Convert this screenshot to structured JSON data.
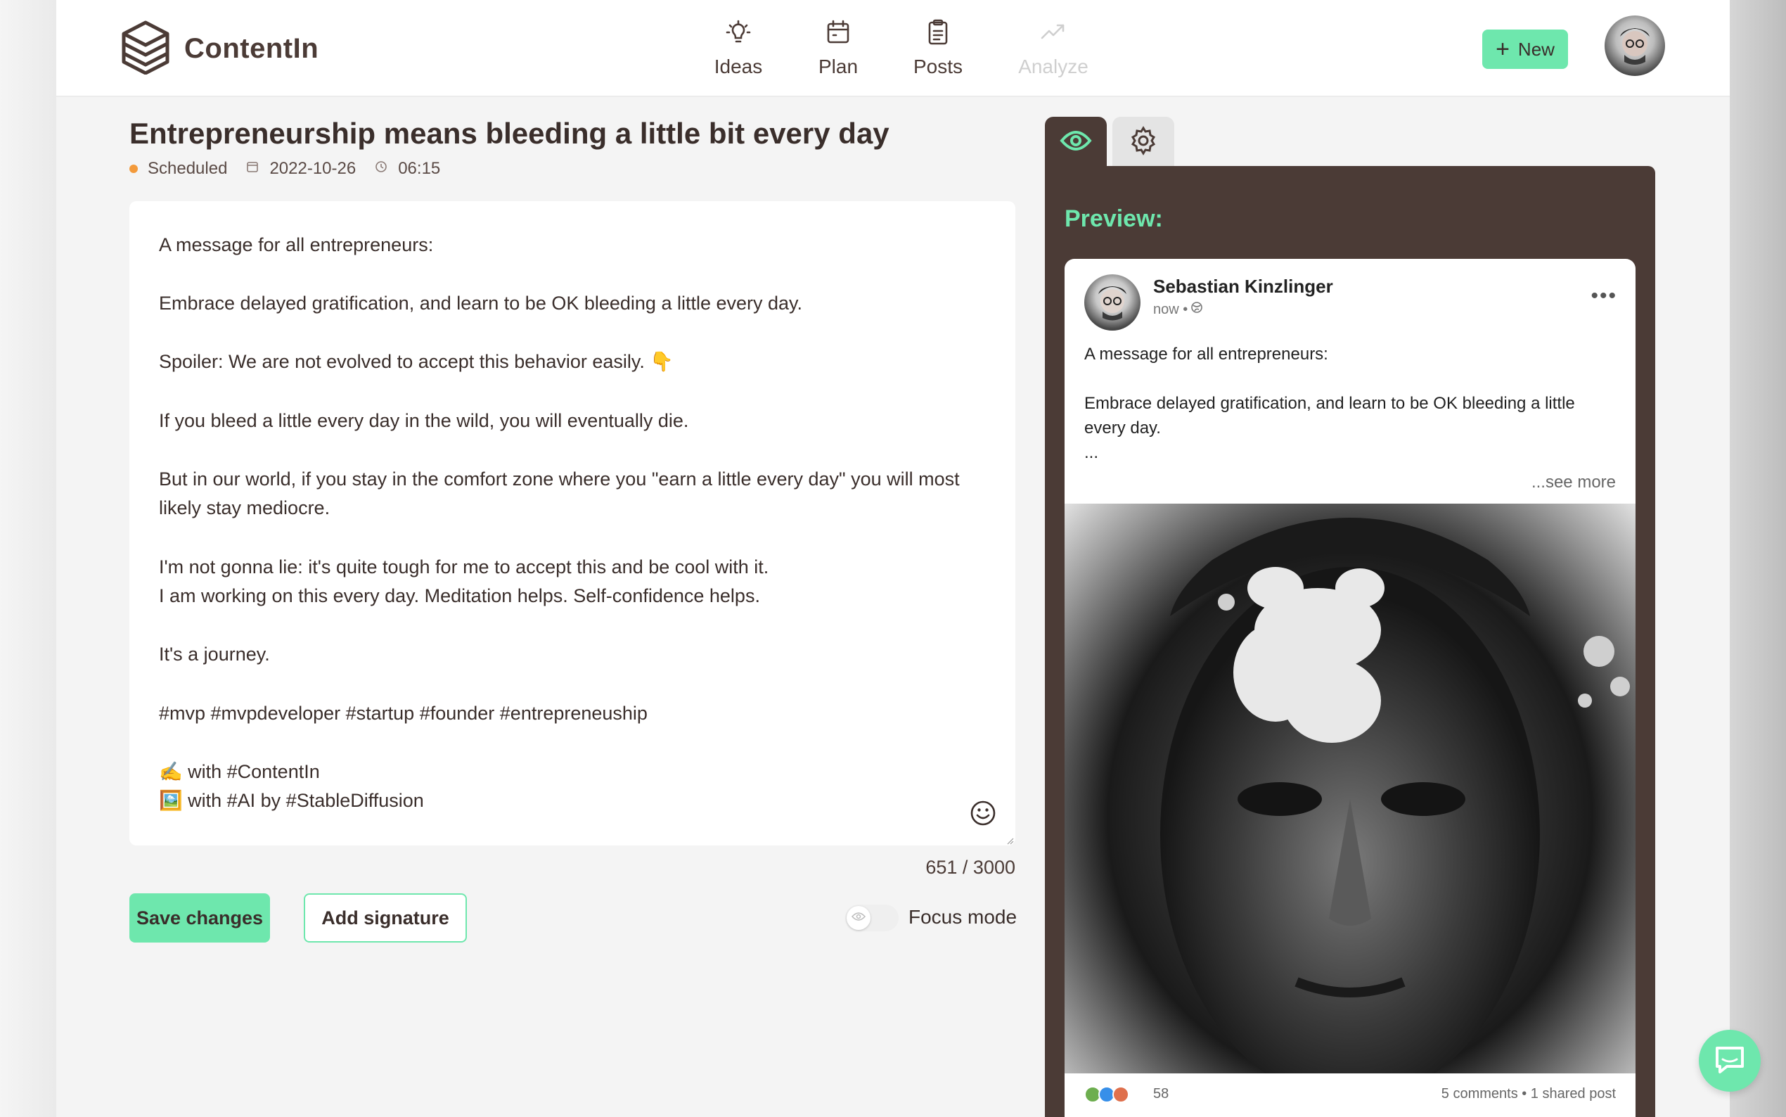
{
  "app": {
    "name": "ContentIn"
  },
  "nav": {
    "items": [
      {
        "label": "Ideas",
        "icon": "lightbulb-icon"
      },
      {
        "label": "Plan",
        "icon": "calendar-icon"
      },
      {
        "label": "Posts",
        "icon": "clipboard-icon"
      },
      {
        "label": "Analyze",
        "icon": "trend-icon",
        "disabled": true
      }
    ]
  },
  "header": {
    "new_label": "New"
  },
  "post": {
    "title": "Entrepreneurship means bleeding a little bit every day",
    "status": "Scheduled",
    "date": "2022-10-26",
    "time": "06:15",
    "body": "A message for all entrepreneurs:\n\nEmbrace delayed gratification, and learn to be OK bleeding a little every day.\n\nSpoiler: We are not evolved to accept this behavior easily. 👇\n\nIf you bleed a little every day in the wild, you will eventually die.\n\nBut in our world, if you stay in the comfort zone where you \"earn a little every day\" you will most likely stay mediocre.\n\nI'm not gonna lie: it's quite tough for me to accept this and be cool with it.\nI am working on this every day. Meditation helps. Self-confidence helps.\n\nIt's a journey.\n\n#mvp #mvpdeveloper #startup #founder #entrepreneuship\n\n✍️ with #ContentIn\n🖼️ with #AI by #StableDiffusion",
    "char_count": "651 / 3000"
  },
  "actions": {
    "save_label": "Save changes",
    "signature_label": "Add signature",
    "focus_label": "Focus mode"
  },
  "preview": {
    "label": "Preview:",
    "author": "Sebastian Kinzlinger",
    "time": "now •",
    "excerpt": "A message for all entrepreneurs:\n\nEmbrace delayed gratification, and learn to be OK bleeding a little every day.\n...",
    "see_more": "...see more",
    "reaction_count": "58",
    "stats": "5 comments • 1 shared post"
  },
  "colors": {
    "accent": "#6ee7ad",
    "panel": "#4b3b36",
    "status_scheduled": "#f39a3b"
  }
}
